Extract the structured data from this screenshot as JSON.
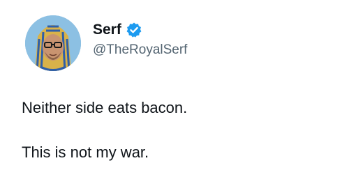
{
  "author": {
    "display_name": "Serf",
    "handle": "@TheRoyalSerf",
    "verified_icon": "verified-badge-icon",
    "accent_color": "#1d9bf0"
  },
  "tweet": {
    "lines": [
      "Neither side eats bacon.",
      "This is not my war."
    ]
  }
}
